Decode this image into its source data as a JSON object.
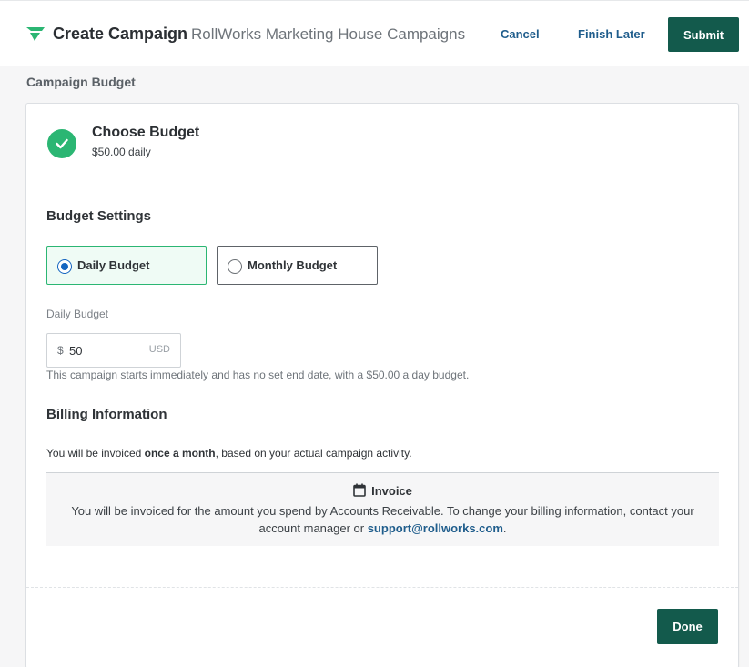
{
  "header": {
    "title": "Create Campaign",
    "subtitle": "RollWorks Marketing House Campaigns",
    "cancel_label": "Cancel",
    "finish_later_label": "Finish Later",
    "submit_label": "Submit",
    "logo_icon": "rollworks-logo-icon"
  },
  "page": {
    "section_label": "Campaign Budget"
  },
  "step": {
    "title": "Choose Budget",
    "summary": "$50.00 daily",
    "status_icon": "check-circle-icon"
  },
  "budget_settings": {
    "heading": "Budget Settings",
    "options": [
      {
        "label": "Daily Budget",
        "selected": true
      },
      {
        "label": "Monthly Budget",
        "selected": false
      }
    ],
    "field_label": "Daily Budget",
    "currency_symbol": "$",
    "amount": "50",
    "unit": "USD",
    "helper_text": "This campaign starts immediately and has no set end date, with a $50.00 a day budget."
  },
  "billing": {
    "heading": "Billing Information",
    "text_before": "You will be invoiced ",
    "text_bold": "once a month",
    "text_after": ", based on your actual campaign activity.",
    "invoice_title": "Invoice",
    "invoice_icon": "calendar-icon",
    "invoice_text": "You will be invoiced for the amount you spend by Accounts Receivable. To change your billing information, contact your account manager or ",
    "support_email": "support@rollworks.com",
    "invoice_text_end": "."
  },
  "footer": {
    "done_label": "Done"
  },
  "colors": {
    "primary_button": "#135a4c",
    "success_green": "#2bb673",
    "link_blue": "#1f5d8c",
    "radio_blue": "#1565c0"
  }
}
